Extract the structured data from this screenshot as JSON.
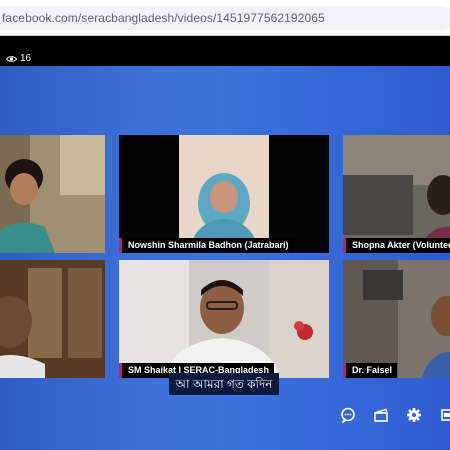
{
  "browser": {
    "url": "facebook.com/seracbangladesh/videos/1451977562192065"
  },
  "stream": {
    "viewer_count": "16"
  },
  "participants": [
    {
      "name": ""
    },
    {
      "name": "Nowshin Sharmila Badhon (Jatrabari)"
    },
    {
      "name": "Shopna Akter (Volunteer- I"
    },
    {
      "name": ""
    },
    {
      "name": "SM Shaikat I SERAC-Bangladesh"
    },
    {
      "name": "Dr. Faisel"
    }
  ],
  "caption": {
    "text": "আ আমরা গত কদিন"
  },
  "controls": [
    {
      "icon": "comment-icon"
    },
    {
      "icon": "clapperboard-icon"
    },
    {
      "icon": "gear-icon"
    },
    {
      "icon": "fullscreen-icon"
    }
  ],
  "colors": {
    "stage_blue": "#3a74dc",
    "label_accent": "#e0116b"
  }
}
